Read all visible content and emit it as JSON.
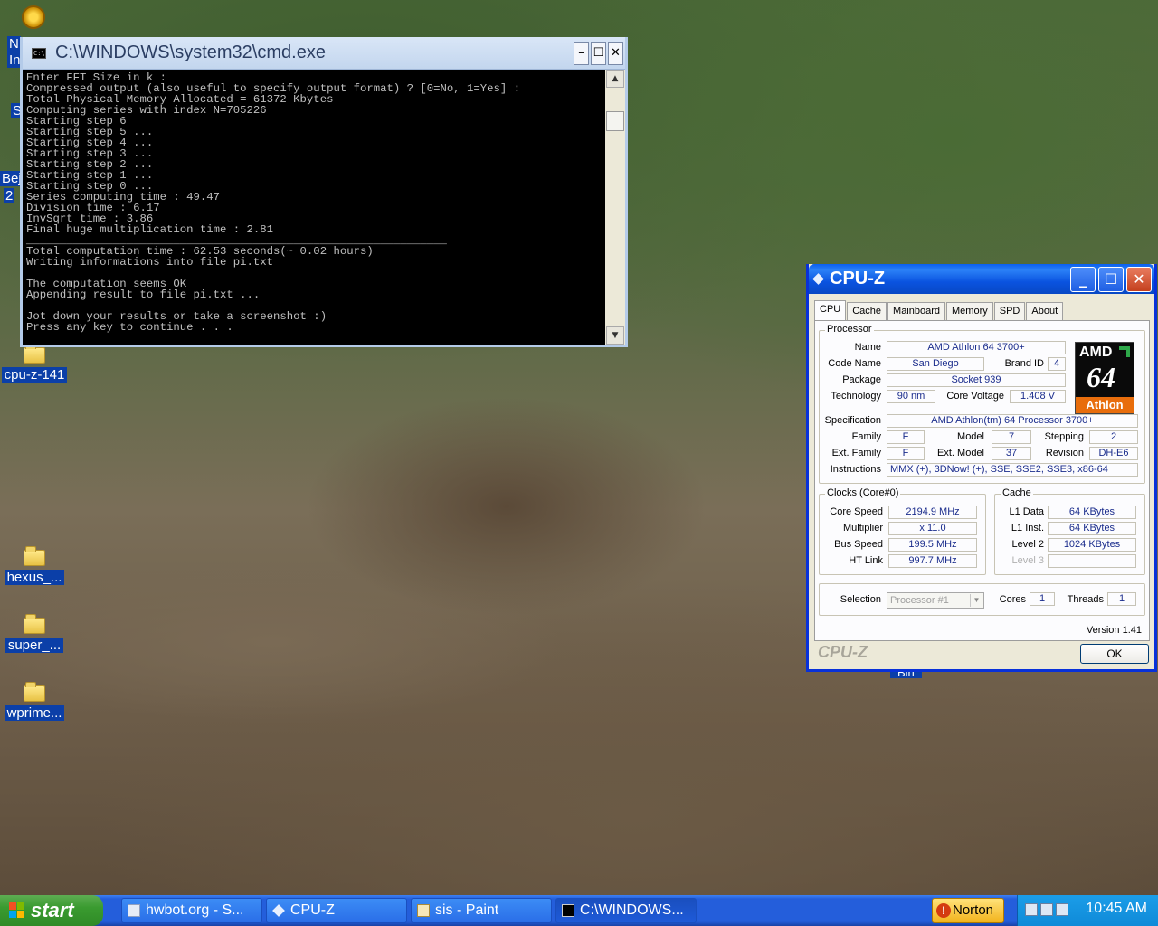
{
  "desktop": {
    "edge_labels": [
      "N",
      "In",
      "S",
      "Bej",
      "2"
    ],
    "icons": [
      {
        "label": "cpu-z-141"
      },
      {
        "label": "hexus_..."
      },
      {
        "label": "super_..."
      },
      {
        "label": "wprime..."
      }
    ],
    "partial_label": "Bin"
  },
  "cmd": {
    "title": "C:\\WINDOWS\\system32\\cmd.exe",
    "lines": [
      "Enter FFT Size in k :",
      "Compressed output (also useful to specify output format) ? [0=No, 1=Yes] :",
      "Total Physical Memory Allocated = 61372 Kbytes",
      "Computing series with index N=705226",
      "Starting step 6",
      "Starting step 5 ...",
      "Starting step 4 ...",
      "Starting step 3 ...",
      "Starting step 2 ...",
      "Starting step 1 ...",
      "Starting step 0 ...",
      "Series computing time : 49.47",
      "Division time : 6.17",
      "InvSqrt time : 3.86",
      "Final huge multiplication time : 2.81",
      "_______________________________________________________________",
      "Total computation time : 62.53 seconds(~ 0.02 hours)",
      "Writing informations into file pi.txt",
      "",
      "The computation seems OK",
      "Appending result to file pi.txt ...",
      "",
      "Jot down your results or take a screenshot :)",
      "Press any key to continue . . ."
    ]
  },
  "cpuz": {
    "title": "CPU-Z",
    "tabs": [
      "CPU",
      "Cache",
      "Mainboard",
      "Memory",
      "SPD",
      "About"
    ],
    "active_tab": "CPU",
    "processor": {
      "group": "Processor",
      "name_label": "Name",
      "name": "AMD Athlon 64 3700+",
      "codename_label": "Code Name",
      "codename": "San Diego",
      "brandid_label": "Brand ID",
      "brandid": "4",
      "package_label": "Package",
      "package": "Socket 939",
      "technology_label": "Technology",
      "technology": "90 nm",
      "corevoltage_label": "Core Voltage",
      "corevoltage": "1.408 V",
      "spec_label": "Specification",
      "spec": "AMD Athlon(tm) 64 Processor 3700+",
      "family_label": "Family",
      "family": "F",
      "model_label": "Model",
      "model": "7",
      "stepping_label": "Stepping",
      "stepping": "2",
      "extfamily_label": "Ext. Family",
      "extfamily": "F",
      "extmodel_label": "Ext. Model",
      "extmodel": "37",
      "revision_label": "Revision",
      "revision": "DH-E6",
      "instructions_label": "Instructions",
      "instructions": "MMX (+), 3DNow! (+), SSE, SSE2, SSE3, x86-64",
      "logo": {
        "brand": "AMD",
        "number": "64",
        "line": "Athlon"
      }
    },
    "clocks": {
      "group": "Clocks (Core#0)",
      "corespeed_label": "Core Speed",
      "corespeed": "2194.9 MHz",
      "multiplier_label": "Multiplier",
      "multiplier": "x 11.0",
      "busspeed_label": "Bus Speed",
      "busspeed": "199.5 MHz",
      "htlink_label": "HT Link",
      "htlink": "997.7 MHz"
    },
    "cache": {
      "group": "Cache",
      "l1data_label": "L1 Data",
      "l1data": "64 KBytes",
      "l1inst_label": "L1 Inst.",
      "l1inst": "64 KBytes",
      "level2_label": "Level 2",
      "level2": "1024 KBytes",
      "level3_label": "Level 3",
      "level3": ""
    },
    "selection": {
      "label": "Selection",
      "value": "Processor #1",
      "cores_label": "Cores",
      "cores": "1",
      "threads_label": "Threads",
      "threads": "1"
    },
    "version": "Version 1.41",
    "footer_brand": "CPU-Z",
    "ok_label": "OK"
  },
  "taskbar": {
    "start_label": "start",
    "tasks": [
      {
        "label": "hwbot.org - S...",
        "icon": "browser-icon"
      },
      {
        "label": "CPU-Z",
        "icon": "cpuz-icon"
      },
      {
        "label": "sis - Paint",
        "icon": "paint-icon"
      },
      {
        "label": "C:\\WINDOWS...",
        "icon": "cmd-icon"
      }
    ],
    "norton_label": "Norton",
    "clock": "10:45 AM"
  }
}
